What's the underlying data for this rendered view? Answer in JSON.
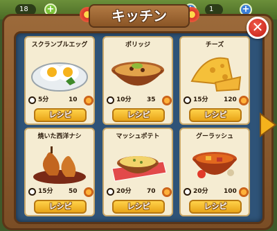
{
  "topbar": {
    "left_count": "18",
    "right_count": "1"
  },
  "window": {
    "title": "キッチン"
  },
  "colors": {
    "frame_wood": "#8a5a2e",
    "panel_blue": "#2e5378",
    "card_bg": "#f5ecd2",
    "button_gold": "#f3b52c",
    "close_red": "#d42a1d"
  },
  "recipes": [
    {
      "name": "スクランブルエッグ",
      "time": "5分",
      "gain": "10",
      "button": "レシピ",
      "icon": "scrambled-eggs-icon"
    },
    {
      "name": "ポリッジ",
      "time": "10分",
      "gain": "35",
      "button": "レシピ",
      "icon": "porridge-icon"
    },
    {
      "name": "チーズ",
      "time": "15分",
      "gain": "120",
      "button": "レシピ",
      "icon": "cheese-icon"
    },
    {
      "name": "焼いた西洋ナシ",
      "time": "15分",
      "gain": "50",
      "button": "レシピ",
      "icon": "baked-pear-icon"
    },
    {
      "name": "マッシュポテト",
      "time": "20分",
      "gain": "70",
      "button": "レシピ",
      "icon": "mashed-potato-icon"
    },
    {
      "name": "グーラッシュ",
      "time": "20分",
      "gain": "100",
      "button": "レシピ",
      "icon": "goulash-icon"
    }
  ]
}
